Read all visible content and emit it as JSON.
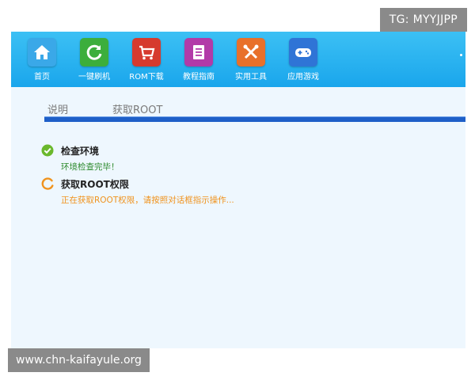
{
  "watermarks": {
    "top": "TG: MYYJJPP",
    "bottom": "www.chn-kaifayule.org"
  },
  "toolbar": {
    "items": [
      {
        "label": "首页",
        "icon": "home-icon",
        "color": "#3aa8e8"
      },
      {
        "label": "一键刷机",
        "icon": "refresh-icon",
        "color": "#3cae3c"
      },
      {
        "label": "ROM下载",
        "icon": "cart-icon",
        "color": "#d63a2e"
      },
      {
        "label": "教程指南",
        "icon": "book-icon",
        "color": "#b23aa8"
      },
      {
        "label": "实用工具",
        "icon": "tools-icon",
        "color": "#e8702a"
      },
      {
        "label": "应用游戏",
        "icon": "gamepad-icon",
        "color": "#2f74d6"
      }
    ]
  },
  "tabs": [
    "说明",
    "获取ROOT"
  ],
  "steps": [
    {
      "title": "检查环境",
      "message": "环境检查完毕！",
      "status": "done",
      "icon": "check-circle-icon",
      "color": "#6ab82c"
    },
    {
      "title": "获取ROOT权限",
      "message": "正在获取ROOT权限，请按照对话框指示操作...",
      "status": "in-progress",
      "icon": "spinner-icon",
      "color": "#f0931e"
    }
  ]
}
